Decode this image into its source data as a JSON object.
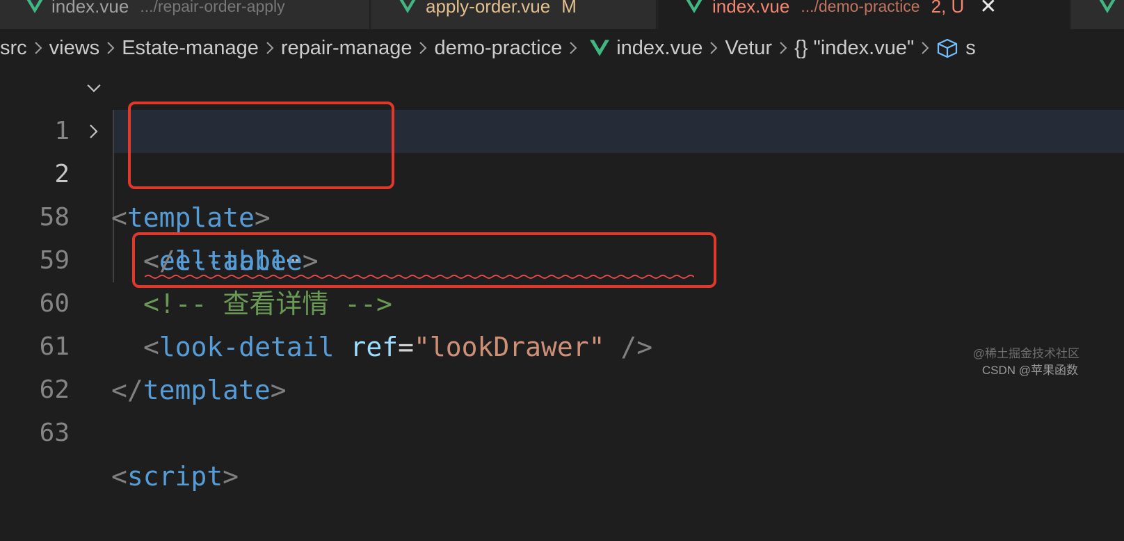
{
  "tabs": [
    {
      "name": "index.vue",
      "path": ".../repair-order-apply",
      "active": false
    },
    {
      "name": "apply-order.vue",
      "badge": "M",
      "active": false
    },
    {
      "name": "index.vue",
      "path": ".../demo-practice",
      "badge": "2, U",
      "close": "✕",
      "active": true
    },
    {
      "name": "",
      "active": false
    }
  ],
  "breadcrumb": [
    "src",
    "views",
    "Estate-manage",
    "repair-manage",
    "demo-practice",
    "index.vue",
    "Vetur",
    "{} \"index.vue\"",
    "s"
  ],
  "editor": {
    "lines": [
      {
        "number": "1",
        "parts": [
          "<",
          "template",
          ">"
        ]
      },
      {
        "number": "2",
        "parts": [
          "<",
          "el-table",
          "⋯"
        ]
      },
      {
        "number": "58",
        "parts": [
          "</",
          "el-table",
          ">"
        ]
      },
      {
        "number": "59",
        "parts": [
          "<!-- 查看详情 -->"
        ]
      },
      {
        "number": "60",
        "parts": [
          "<",
          "look-detail",
          " ",
          "ref",
          "=",
          "\"lookDrawer\"",
          " />"
        ]
      },
      {
        "number": "61",
        "parts": [
          "</",
          "template",
          ">"
        ]
      },
      {
        "number": "62",
        "parts": []
      },
      {
        "number": "63",
        "parts": [
          "<",
          "script",
          ">"
        ]
      }
    ]
  },
  "watermark": {
    "line1": "@稀土掘金技术社区",
    "line2": "CSDN @苹果函数"
  },
  "colors": {
    "vue_green": "#41b883",
    "highlight_red": "#e0392b",
    "tag_blue": "#569cd6",
    "string_orange": "#ce9178",
    "comment_green": "#6a9955",
    "modified_yellow": "#e2c08d",
    "error_red": "#f48771"
  }
}
